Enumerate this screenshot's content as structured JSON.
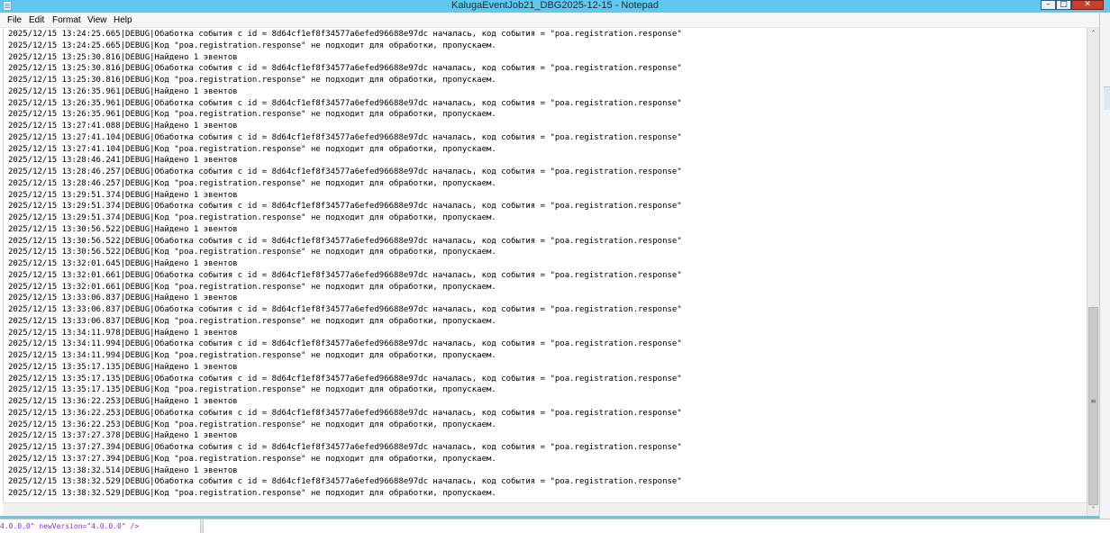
{
  "window": {
    "title": "KalugaEventJob21_DBG2025-12-15 - Notepad",
    "minimize_glyph": "–",
    "maximize_glyph": "□",
    "close_glyph": "✕",
    "app_icon": "notepad-icon",
    "title_bar_color": "#5ec8ee",
    "close_button_color": "#c7402d"
  },
  "menu": {
    "file": "File",
    "edit": "Edit",
    "format": "Format",
    "view": "View",
    "help": "Help"
  },
  "editor": {
    "lines": [
      "2025/12/15 13:24:25.665|DEBUG|Обаботка события с id = 8d64cf1ef8f34577a6efed96688e97dc началась, код события = \"poa.registration.response\"",
      "2025/12/15 13:24:25.665|DEBUG|Код \"poa.registration.response\" не подходит для обработки, пропускаем.",
      "2025/12/15 13:25:30.816|DEBUG|Найдено 1 эвентов",
      "2025/12/15 13:25:30.816|DEBUG|Обаботка события с id = 8d64cf1ef8f34577a6efed96688e97dc началась, код события = \"poa.registration.response\"",
      "2025/12/15 13:25:30.816|DEBUG|Код \"poa.registration.response\" не подходит для обработки, пропускаем.",
      "2025/12/15 13:26:35.961|DEBUG|Найдено 1 эвентов",
      "2025/12/15 13:26:35.961|DEBUG|Обаботка события с id = 8d64cf1ef8f34577a6efed96688e97dc началась, код события = \"poa.registration.response\"",
      "2025/12/15 13:26:35.961|DEBUG|Код \"poa.registration.response\" не подходит для обработки, пропускаем.",
      "2025/12/15 13:27:41.088|DEBUG|Найдено 1 эвентов",
      "2025/12/15 13:27:41.104|DEBUG|Обаботка события с id = 8d64cf1ef8f34577a6efed96688e97dc началась, код события = \"poa.registration.response\"",
      "2025/12/15 13:27:41.104|DEBUG|Код \"poa.registration.response\" не подходит для обработки, пропускаем.",
      "2025/12/15 13:28:46.241|DEBUG|Найдено 1 эвентов",
      "2025/12/15 13:28:46.257|DEBUG|Обаботка события с id = 8d64cf1ef8f34577a6efed96688e97dc началась, код события = \"poa.registration.response\"",
      "2025/12/15 13:28:46.257|DEBUG|Код \"poa.registration.response\" не подходит для обработки, пропускаем.",
      "2025/12/15 13:29:51.374|DEBUG|Найдено 1 эвентов",
      "2025/12/15 13:29:51.374|DEBUG|Обаботка события с id = 8d64cf1ef8f34577a6efed96688e97dc началась, код события = \"poa.registration.response\"",
      "2025/12/15 13:29:51.374|DEBUG|Код \"poa.registration.response\" не подходит для обработки, пропускаем.",
      "2025/12/15 13:30:56.522|DEBUG|Найдено 1 эвентов",
      "2025/12/15 13:30:56.522|DEBUG|Обаботка события с id = 8d64cf1ef8f34577a6efed96688e97dc началась, код события = \"poa.registration.response\"",
      "2025/12/15 13:30:56.522|DEBUG|Код \"poa.registration.response\" не подходит для обработки, пропускаем.",
      "2025/12/15 13:32:01.645|DEBUG|Найдено 1 эвентов",
      "2025/12/15 13:32:01.661|DEBUG|Обаботка события с id = 8d64cf1ef8f34577a6efed96688e97dc началась, код события = \"poa.registration.response\"",
      "2025/12/15 13:32:01.661|DEBUG|Код \"poa.registration.response\" не подходит для обработки, пропускаем.",
      "2025/12/15 13:33:06.837|DEBUG|Найдено 1 эвентов",
      "2025/12/15 13:33:06.837|DEBUG|Обаботка события с id = 8d64cf1ef8f34577a6efed96688e97dc началась, код события = \"poa.registration.response\"",
      "2025/12/15 13:33:06.837|DEBUG|Код \"poa.registration.response\" не подходит для обработки, пропускаем.",
      "2025/12/15 13:34:11.978|DEBUG|Найдено 1 эвентов",
      "2025/12/15 13:34:11.994|DEBUG|Обаботка события с id = 8d64cf1ef8f34577a6efed96688e97dc началась, код события = \"poa.registration.response\"",
      "2025/12/15 13:34:11.994|DEBUG|Код \"poa.registration.response\" не подходит для обработки, пропускаем.",
      "2025/12/15 13:35:17.135|DEBUG|Найдено 1 эвентов",
      "2025/12/15 13:35:17.135|DEBUG|Обаботка события с id = 8d64cf1ef8f34577a6efed96688e97dc началась, код события = \"poa.registration.response\"",
      "2025/12/15 13:35:17.135|DEBUG|Код \"poa.registration.response\" не подходит для обработки, пропускаем.",
      "2025/12/15 13:36:22.253|DEBUG|Найдено 1 эвентов",
      "2025/12/15 13:36:22.253|DEBUG|Обаботка события с id = 8d64cf1ef8f34577a6efed96688e97dc началась, код события = \"poa.registration.response\"",
      "2025/12/15 13:36:22.253|DEBUG|Код \"poa.registration.response\" не подходит для обработки, пропускаем.",
      "2025/12/15 13:37:27.378|DEBUG|Найдено 1 эвентов",
      "2025/12/15 13:37:27.394|DEBUG|Обаботка события с id = 8d64cf1ef8f34577a6efed96688e97dc началась, код события = \"poa.registration.response\"",
      "2025/12/15 13:37:27.394|DEBUG|Код \"poa.registration.response\" не подходит для обработки, пропускаем.",
      "2025/12/15 13:38:32.514|DEBUG|Найдено 1 эвентов",
      "2025/12/15 13:38:32.529|DEBUG|Обаботка события с id = 8d64cf1ef8f34577a6efed96688e97dc началась, код события = \"poa.registration.response\"",
      "2025/12/15 13:38:32.529|DEBUG|Код \"poa.registration.response\" не подходит для обработки, пропускаем."
    ]
  },
  "scrollbar": {
    "up_glyph": "˄",
    "down_glyph": "˅",
    "grip_glyph": "≡"
  },
  "background_window": {
    "visible_code": "4.0.0.0\" newVersion=\"4.0.0.0\" />"
  }
}
